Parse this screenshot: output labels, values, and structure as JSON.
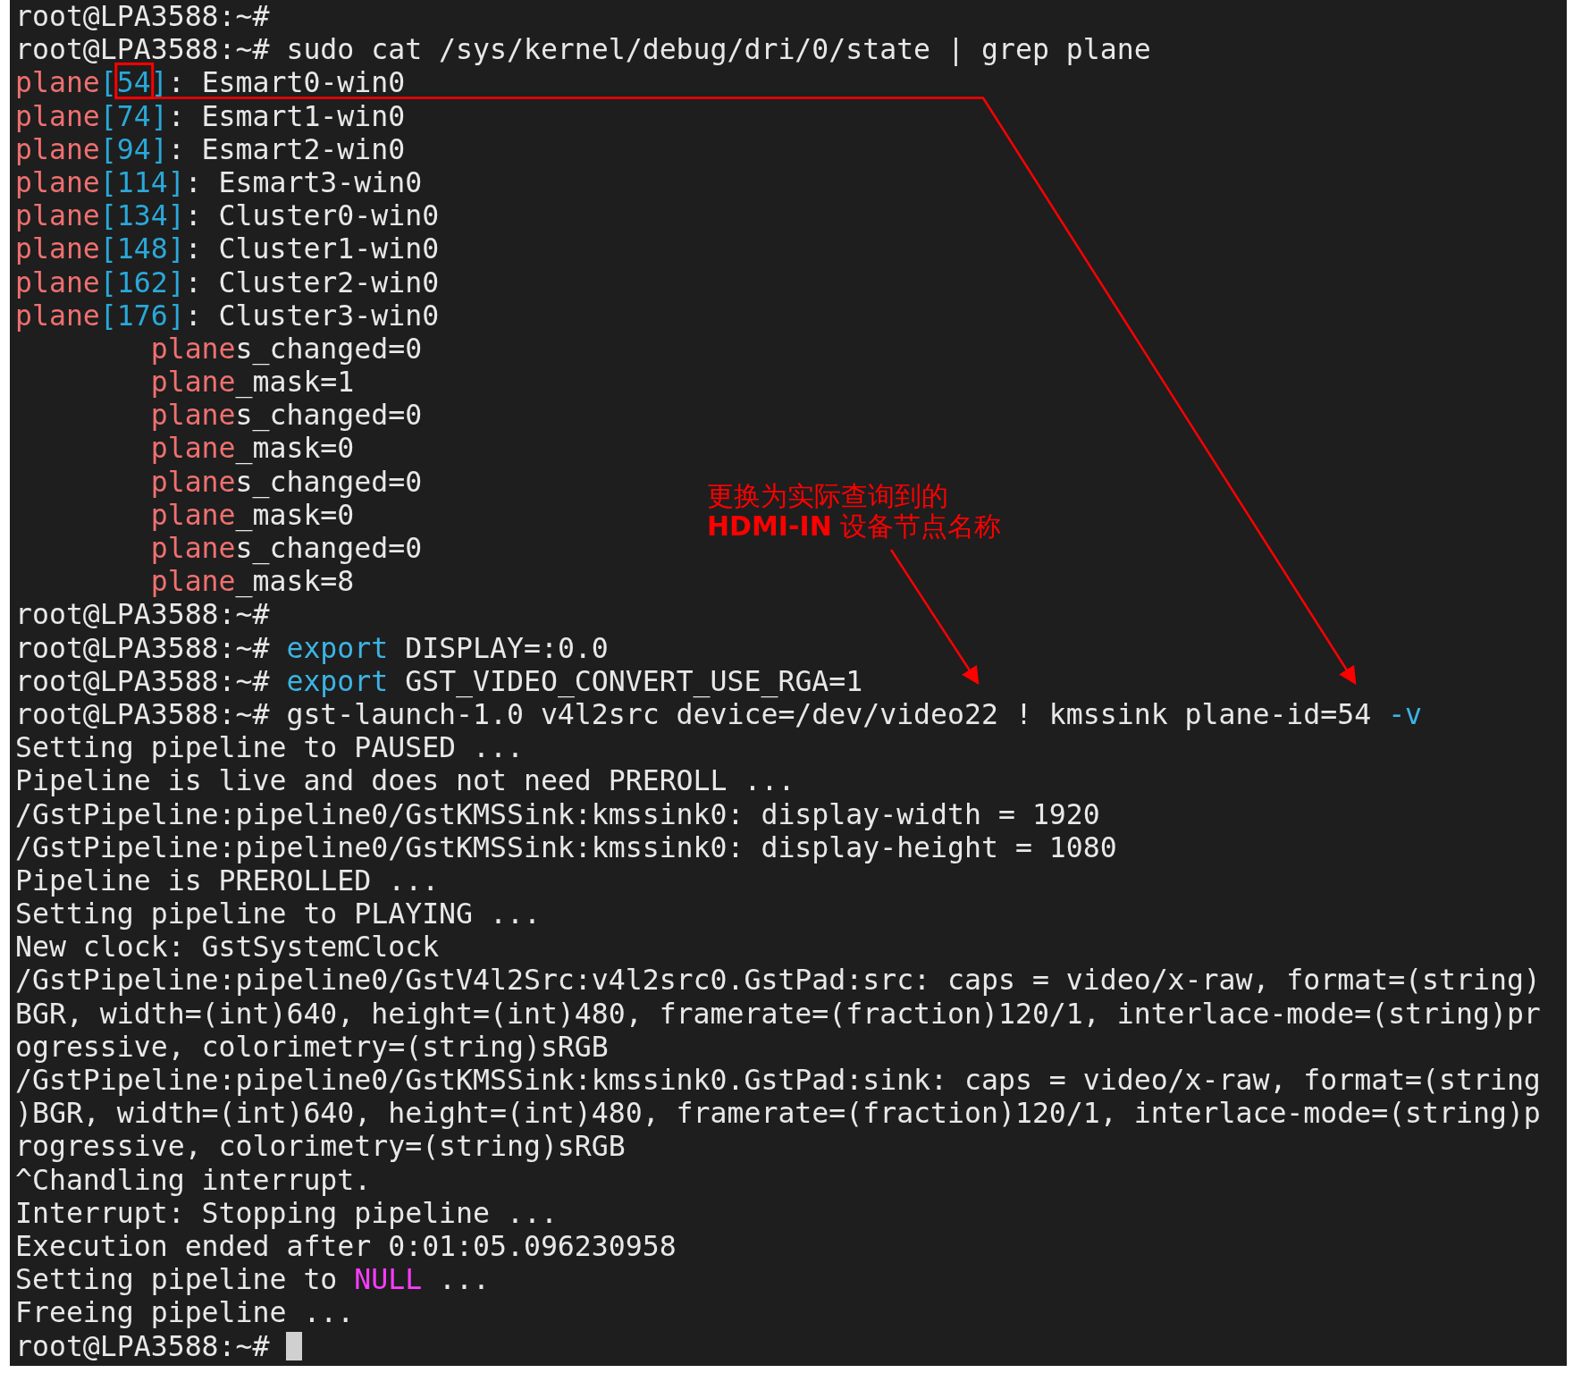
{
  "terminal": {
    "lines": [
      [
        {
          "text": "root@LPA3588:~#",
          "kind": "plain"
        }
      ],
      [
        {
          "text": "root@LPA3588:~# sudo cat /sys/kernel/debug/dri/0/state | grep plane",
          "kind": "plain"
        }
      ],
      [
        {
          "text": "plane",
          "kind": "match"
        },
        {
          "text": "[",
          "kind": "index"
        },
        {
          "text": "54",
          "kind": "index",
          "boxed": true
        },
        {
          "text": "]",
          "kind": "index"
        },
        {
          "text": ": Esmart0-win0",
          "kind": "plain"
        }
      ],
      [
        {
          "text": "plane",
          "kind": "match"
        },
        {
          "text": "[74]",
          "kind": "index"
        },
        {
          "text": ": Esmart1-win0",
          "kind": "plain"
        }
      ],
      [
        {
          "text": "plane",
          "kind": "match"
        },
        {
          "text": "[94]",
          "kind": "index"
        },
        {
          "text": ": Esmart2-win0",
          "kind": "plain"
        }
      ],
      [
        {
          "text": "plane",
          "kind": "match"
        },
        {
          "text": "[114]",
          "kind": "index"
        },
        {
          "text": ": Esmart3-win0",
          "kind": "plain"
        }
      ],
      [
        {
          "text": "plane",
          "kind": "match"
        },
        {
          "text": "[134]",
          "kind": "index"
        },
        {
          "text": ": Cluster0-win0",
          "kind": "plain"
        }
      ],
      [
        {
          "text": "plane",
          "kind": "match"
        },
        {
          "text": "[148]",
          "kind": "index"
        },
        {
          "text": ": Cluster1-win0",
          "kind": "plain"
        }
      ],
      [
        {
          "text": "plane",
          "kind": "match"
        },
        {
          "text": "[162]",
          "kind": "index"
        },
        {
          "text": ": Cluster2-win0",
          "kind": "plain"
        }
      ],
      [
        {
          "text": "plane",
          "kind": "match"
        },
        {
          "text": "[176]",
          "kind": "index"
        },
        {
          "text": ": Cluster3-win0",
          "kind": "plain"
        }
      ],
      [
        {
          "kind": "indent"
        },
        {
          "text": "plane",
          "kind": "match"
        },
        {
          "text": "s_changed=0",
          "kind": "plain"
        }
      ],
      [
        {
          "kind": "indent"
        },
        {
          "text": "plane",
          "kind": "match"
        },
        {
          "text": "_mask=1",
          "kind": "plain"
        }
      ],
      [
        {
          "kind": "indent"
        },
        {
          "text": "plane",
          "kind": "match"
        },
        {
          "text": "s_changed=0",
          "kind": "plain"
        }
      ],
      [
        {
          "kind": "indent"
        },
        {
          "text": "plane",
          "kind": "match"
        },
        {
          "text": "_mask=0",
          "kind": "plain"
        }
      ],
      [
        {
          "kind": "indent"
        },
        {
          "text": "plane",
          "kind": "match"
        },
        {
          "text": "s_changed=0",
          "kind": "plain"
        }
      ],
      [
        {
          "kind": "indent"
        },
        {
          "text": "plane",
          "kind": "match"
        },
        {
          "text": "_mask=0",
          "kind": "plain"
        }
      ],
      [
        {
          "kind": "indent"
        },
        {
          "text": "plane",
          "kind": "match"
        },
        {
          "text": "s_changed=0",
          "kind": "plain"
        }
      ],
      [
        {
          "kind": "indent"
        },
        {
          "text": "plane",
          "kind": "match"
        },
        {
          "text": "_mask=8",
          "kind": "plain"
        }
      ],
      [
        {
          "text": "root@LPA3588:~#",
          "kind": "plain"
        }
      ],
      [
        {
          "text": "root@LPA3588:~# ",
          "kind": "plain"
        },
        {
          "text": "export",
          "kind": "keyword"
        },
        {
          "text": " DISPLAY=:0.0",
          "kind": "plain"
        }
      ],
      [
        {
          "text": "root@LPA3588:~# ",
          "kind": "plain"
        },
        {
          "text": "export",
          "kind": "keyword"
        },
        {
          "text": " GST_VIDEO_CONVERT_USE_RGA=1",
          "kind": "plain"
        }
      ],
      [
        {
          "text": "root@LPA3588:~# gst-launch-1.0 v4l2src device=/dev/video22 ! kmssink plane-id=54 ",
          "kind": "plain"
        },
        {
          "text": "-v",
          "kind": "keyword"
        }
      ],
      [
        {
          "text": "Setting pipeline to PAUSED ...",
          "kind": "plain"
        }
      ],
      [
        {
          "text": "Pipeline is live and does not need PREROLL ...",
          "kind": "plain"
        }
      ],
      [
        {
          "text": "/GstPipeline:pipeline0/GstKMSSink:kmssink0: display-width = 1920",
          "kind": "plain"
        }
      ],
      [
        {
          "text": "/GstPipeline:pipeline0/GstKMSSink:kmssink0: display-height = 1080",
          "kind": "plain"
        }
      ],
      [
        {
          "text": "Pipeline is PREROLLED ...",
          "kind": "plain"
        }
      ],
      [
        {
          "text": "Setting pipeline to PLAYING ...",
          "kind": "plain"
        }
      ],
      [
        {
          "text": "New clock: GstSystemClock",
          "kind": "plain"
        }
      ],
      [
        {
          "text": "/GstPipeline:pipeline0/GstV4l2Src:v4l2src0.GstPad:src: caps = video/x-raw, format=(string)",
          "kind": "plain"
        }
      ],
      [
        {
          "text": "BGR, width=(int)640, height=(int)480, framerate=(fraction)120/1, interlace-mode=(string)pr",
          "kind": "plain"
        }
      ],
      [
        {
          "text": "ogressive, colorimetry=(string)sRGB",
          "kind": "plain"
        }
      ],
      [
        {
          "text": "/GstPipeline:pipeline0/GstKMSSink:kmssink0.GstPad:sink: caps = video/x-raw, format=(string",
          "kind": "plain"
        }
      ],
      [
        {
          "text": ")BGR, width=(int)640, height=(int)480, framerate=(fraction)120/1, interlace-mode=(string)p",
          "kind": "plain"
        }
      ],
      [
        {
          "text": "rogressive, colorimetry=(string)sRGB",
          "kind": "plain"
        }
      ],
      [
        {
          "text": "^Chandling interrupt.",
          "kind": "plain"
        }
      ],
      [
        {
          "text": "Interrupt: Stopping pipeline ...",
          "kind": "plain"
        }
      ],
      [
        {
          "text": "Execution ended after 0:01:05.096230958",
          "kind": "plain"
        }
      ],
      [
        {
          "text": "Setting pipeline to ",
          "kind": "plain"
        },
        {
          "text": "NULL",
          "kind": "null"
        },
        {
          "text": " ...",
          "kind": "plain"
        }
      ],
      [
        {
          "text": "Freeing pipeline ...",
          "kind": "plain"
        }
      ],
      [
        {
          "text": "root@LPA3588:~# ",
          "kind": "plain"
        }
      ]
    ],
    "cursor": true
  },
  "annotation": {
    "note": "更换为实际查询到的\n**HDMI-IN** 设备节点名称"
  }
}
